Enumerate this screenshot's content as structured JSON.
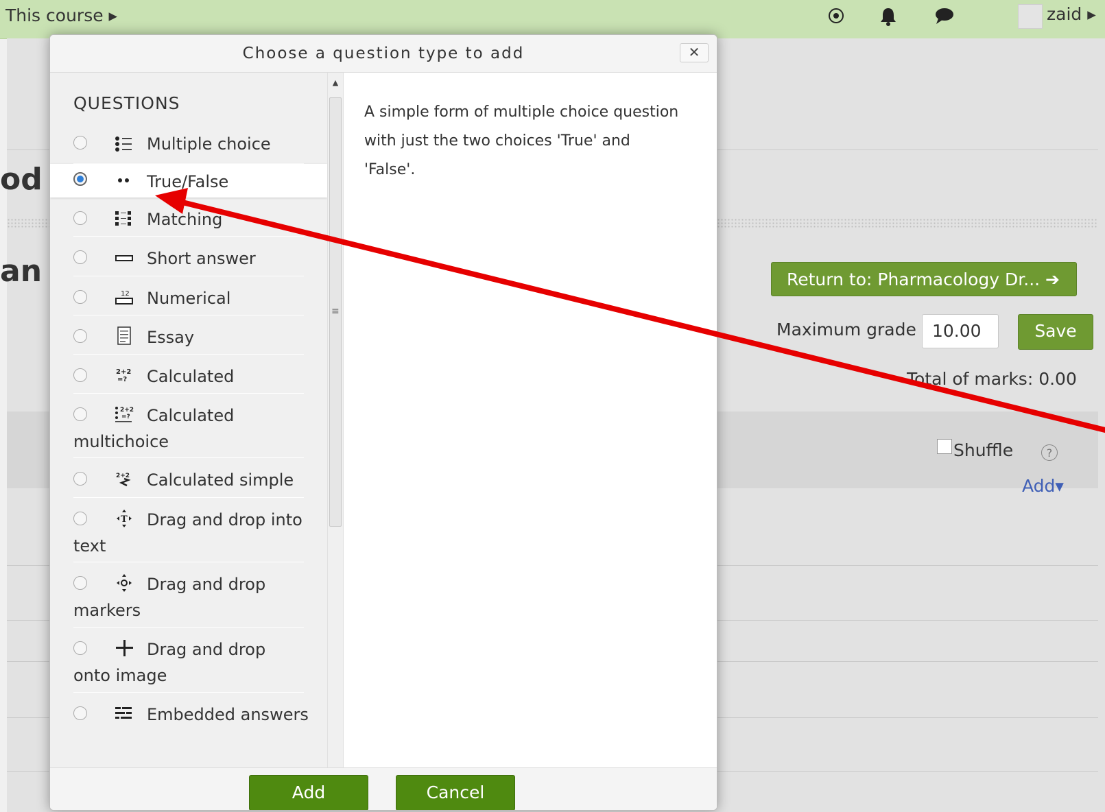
{
  "topbar": {
    "course_label": "This course ▸",
    "user_name": "zaid ▸",
    "icons": [
      "add-circle-icon",
      "bell-icon",
      "chat-bubble-icon"
    ]
  },
  "page": {
    "heading_fragment_1": "od",
    "heading_fragment_2": "an",
    "return_button_label": "Return to: Pharmacology Dr... ➔",
    "max_grade_label": "Maximum grade",
    "max_grade_value": "10.00",
    "save_button_label": "Save",
    "total_marks_label": "Total of marks: 0.00",
    "shuffle_label": "Shuffle",
    "help_glyph": "?",
    "add_link_label": "Add▾"
  },
  "modal": {
    "title": "Choose a question type to add",
    "close_glyph": "✕",
    "section_heading": "QUESTIONS",
    "items": [
      {
        "label": "Multiple choice",
        "label2": "",
        "icon": "multiple-choice-icon",
        "selected": false
      },
      {
        "label": "True/False",
        "label2": "",
        "icon": "true-false-icon",
        "selected": true
      },
      {
        "label": "Matching",
        "label2": "",
        "icon": "matching-icon",
        "selected": false
      },
      {
        "label": "Short answer",
        "label2": "",
        "icon": "short-answer-icon",
        "selected": false
      },
      {
        "label": "Numerical",
        "label2": "",
        "icon": "numerical-icon",
        "selected": false
      },
      {
        "label": "Essay",
        "label2": "",
        "icon": "essay-icon",
        "selected": false
      },
      {
        "label": "Calculated",
        "label2": "",
        "icon": "calculated-icon",
        "selected": false
      },
      {
        "label": "Calculated",
        "label2": "multichoice",
        "icon": "calculated-multichoice-icon",
        "selected": false
      },
      {
        "label": "Calculated simple",
        "label2": "",
        "icon": "calculated-simple-icon",
        "selected": false
      },
      {
        "label": "Drag and drop into",
        "label2": "text",
        "icon": "drag-drop-text-icon",
        "selected": false
      },
      {
        "label": "Drag and drop",
        "label2": "markers",
        "icon": "drag-drop-markers-icon",
        "selected": false
      },
      {
        "label": "Drag and drop",
        "label2": "onto image",
        "icon": "drag-drop-image-icon",
        "selected": false
      },
      {
        "label": "Embedded answers",
        "label2": "",
        "icon": "embedded-answers-icon",
        "selected": false
      }
    ],
    "description": "A simple form of multiple choice question with just the two choices 'True' and 'False'.",
    "add_button_label": "Add",
    "cancel_button_label": "Cancel"
  },
  "colors": {
    "topbar": "#c9e2b3",
    "button_green": "#6f9a32",
    "modal_button_green": "#4f8a10",
    "annotation_arrow": "#e60000",
    "link_blue": "#3f5fb6",
    "radio_selected": "#2f7fd8"
  }
}
